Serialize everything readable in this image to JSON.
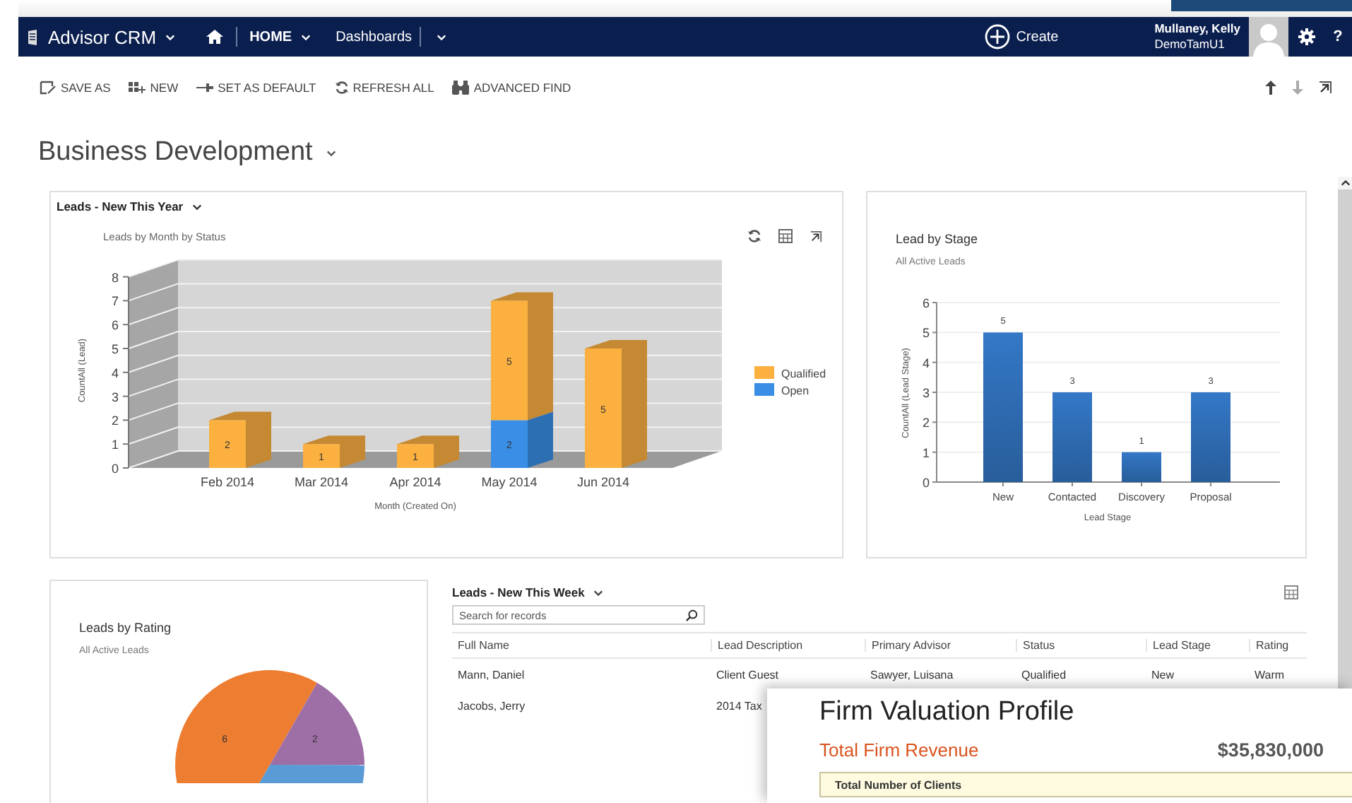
{
  "app": {
    "name": "Advisor CRM"
  },
  "nav": {
    "items": [
      {
        "label": "HOME",
        "kind": "menu"
      },
      {
        "label": "Dashboards",
        "kind": "link"
      }
    ],
    "create": "Create",
    "user": {
      "name": "Mullaney, Kelly",
      "org": "DemoTamU1"
    },
    "help": "?"
  },
  "commands": [
    {
      "label": "SAVE AS",
      "kind": "save"
    },
    {
      "label": "NEW",
      "kind": "new"
    },
    {
      "label": "SET AS DEFAULT",
      "kind": "pin"
    },
    {
      "label": "REFRESH ALL",
      "kind": "refresh"
    },
    {
      "label": "ADVANCED FIND",
      "kind": "find"
    }
  ],
  "dashboard": {
    "title": "Business Development"
  },
  "leads_year": {
    "title": "Leads - New This Year",
    "chart_data": {
      "type": "bar",
      "stacked": true,
      "title": "Leads by Month by Status",
      "xlabel": "Month (Created On)",
      "ylabel": "CountAll (Lead)",
      "categories": [
        "Feb 2014",
        "Mar 2014",
        "Apr 2014",
        "May 2014",
        "Jun 2014"
      ],
      "series": [
        {
          "name": "Qualified",
          "color": "#fbb040",
          "values": [
            2,
            1,
            1,
            5,
            5
          ]
        },
        {
          "name": "Open",
          "color": "#3a8ee6",
          "values": [
            null,
            null,
            null,
            2,
            null
          ]
        }
      ],
      "ylim": [
        0,
        8
      ],
      "yticks": [
        0,
        1,
        2,
        3,
        4,
        5,
        6,
        7,
        8
      ],
      "data_labels": true,
      "legend": true
    }
  },
  "lead_stage": {
    "title": "Lead by Stage",
    "subtitle": "All Active Leads",
    "chart_data": {
      "type": "bar",
      "xlabel": "Lead Stage",
      "ylabel": "CountAll (Lead Stage)",
      "categories": [
        "New",
        "Contacted",
        "Discovery",
        "Proposal"
      ],
      "series": [
        {
          "color": "#2f6db5",
          "values": [
            5,
            3,
            1,
            3
          ]
        }
      ],
      "ylim": [
        0,
        6
      ],
      "yticks": [
        0,
        1,
        2,
        3,
        4,
        5,
        6
      ],
      "data_labels": true,
      "grid": true
    }
  },
  "lead_rating": {
    "title": "Leads by Rating",
    "subtitle": "All Active Leads",
    "chart_data": {
      "type": "pie",
      "series": [
        {
          "values": [
            50,
            16.7,
            33.3
          ]
        }
      ],
      "value_labels": [
        "6",
        "2",
        null
      ]
    }
  },
  "leads_week": {
    "title": "Leads - New This Week",
    "search": {
      "placeholder": "Search for records"
    },
    "columns": [
      "Full Name",
      "Lead Description",
      "Primary Advisor",
      "Status",
      "Lead Stage",
      "Rating"
    ],
    "rows": [
      [
        "Mann, Daniel",
        "Client Guest",
        "Sawyer, Luisana",
        "Qualified",
        "New",
        "Warm"
      ],
      [
        "Jacobs, Jerry",
        "2014 Tax"
      ]
    ]
  },
  "valuation": {
    "title": "Firm Valuation Profile",
    "revenue": {
      "label": "Total Firm Revenue",
      "value": "$35,830,000"
    },
    "rows": [
      {
        "label": "Total Number of Clients"
      }
    ]
  }
}
